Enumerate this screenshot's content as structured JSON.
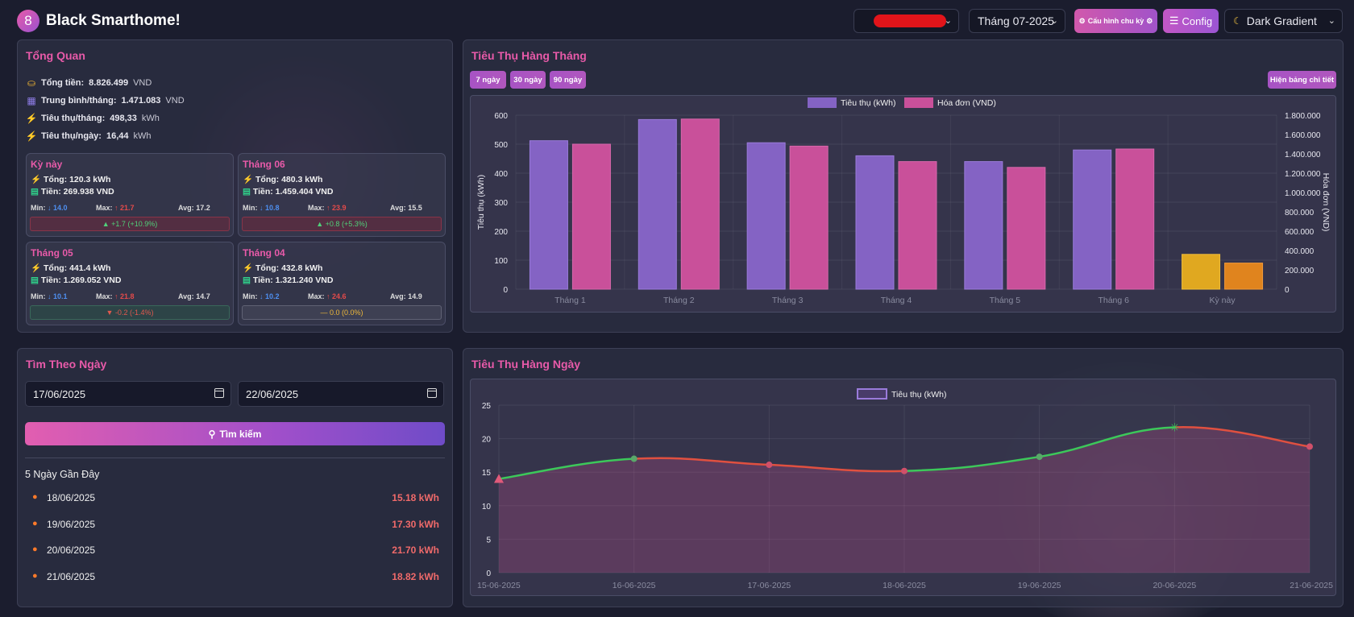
{
  "app": {
    "logo_text": "8",
    "title": "Black Smarthome!"
  },
  "header": {
    "month_select": "Tháng 07-2025",
    "cycle_button": "Cấu hình chu kỳ",
    "config_button": "Config",
    "theme_select": "Dark Gradient"
  },
  "overview": {
    "title": "Tổng Quan",
    "rows": [
      {
        "label": "Tổng tiền:",
        "value": "8.826.499",
        "unit": "VND"
      },
      {
        "label": "Trung bình/tháng:",
        "value": "1.471.083",
        "unit": "VND"
      },
      {
        "label": "Tiêu thụ/tháng:",
        "value": "498,33",
        "unit": "kWh"
      },
      {
        "label": "Tiêu thụ/ngày:",
        "value": "16,44",
        "unit": "kWh"
      }
    ],
    "cards": [
      {
        "title": "Kỳ này",
        "total": "Tổng: 120.3 kWh",
        "money": "Tiền: 269.938 VND",
        "min_label": "Min:",
        "min": "14.0",
        "max_label": "Max:",
        "max": "21.7",
        "avg_label": "Avg:",
        "avg": "17.2",
        "trend": "▲ +1.7 (+10.9%)"
      },
      {
        "title": "Tháng 06",
        "total": "Tổng: 480.3 kWh",
        "money": "Tiền: 1.459.404 VND",
        "min_label": "Min:",
        "min": "10.8",
        "max_label": "Max:",
        "max": "23.9",
        "avg_label": "Avg:",
        "avg": "15.5",
        "trend": "▲ +0.8 (+5.3%)"
      },
      {
        "title": "Tháng 05",
        "total": "Tổng: 441.4 kWh",
        "money": "Tiền: 1.269.052 VND",
        "min_label": "Min:",
        "min": "10.1",
        "max_label": "Max:",
        "max": "21.8",
        "avg_label": "Avg:",
        "avg": "14.7",
        "trend": "▼ -0.2 (-1.4%)"
      },
      {
        "title": "Tháng 04",
        "total": "Tổng: 432.8 kWh",
        "money": "Tiền: 1.321.240 VND",
        "min_label": "Min:",
        "min": "10.2",
        "max_label": "Max:",
        "max": "24.6",
        "avg_label": "Avg:",
        "avg": "14.9",
        "trend": "— 0.0 (0.0%)"
      }
    ]
  },
  "monthly": {
    "title": "Tiêu Thụ Hàng Tháng",
    "ranges": [
      "7 ngày",
      "30 ngày",
      "90 ngày"
    ],
    "detail_button": "Hiện bảng chi tiết"
  },
  "search": {
    "title": "Tìm Theo Ngày",
    "from_date": "17/06/2025",
    "to_date": "22/06/2025",
    "button": "Tìm kiếm",
    "recent_title": "5 Ngày Gần Đây",
    "recent": [
      {
        "date": "18/06/2025",
        "value": "15.18 kWh"
      },
      {
        "date": "19/06/2025",
        "value": "17.30 kWh"
      },
      {
        "date": "20/06/2025",
        "value": "21.70 kWh"
      },
      {
        "date": "21/06/2025",
        "value": "18.82 kWh"
      }
    ]
  },
  "daily": {
    "title": "Tiêu Thụ Hàng Ngày"
  },
  "colors": {
    "accent": "#e85aa9",
    "bar_kwh": "#8463c4",
    "bar_bill": "#c9509a",
    "bar_current_kwh": "#e0a820",
    "bar_current_bill": "#e0841e",
    "line_up": "#3cc85a",
    "line_down": "#e05040"
  },
  "chart_data": [
    {
      "type": "bar",
      "categories": [
        "Tháng 1",
        "Tháng 2",
        "Tháng 3",
        "Tháng 4",
        "Tháng 5",
        "Tháng 6",
        "Kỳ này"
      ],
      "series": [
        {
          "name": "Tiêu thụ (kWh)",
          "axis": "left",
          "values": [
            512,
            585,
            505,
            460,
            440,
            480,
            120
          ]
        },
        {
          "name": "Hóa đơn (VND)",
          "axis": "right",
          "values": [
            1500000,
            1760000,
            1480000,
            1320000,
            1260000,
            1450000,
            270000
          ]
        }
      ],
      "ylabel": "Tiêu thụ (kWh)",
      "y2label": "Hóa đơn (VND)",
      "ylim": [
        0,
        600
      ],
      "y2lim": [
        0,
        1800000
      ],
      "yticks": [
        "0",
        "100",
        "200",
        "300",
        "400",
        "500",
        "600"
      ],
      "y2ticks": [
        "0",
        "200.000",
        "400.000",
        "600.000",
        "800.000",
        "1.000.000",
        "1.200.000",
        "1.400.000",
        "1.600.000",
        "1.800.000"
      ],
      "legend": "top-center",
      "grid": true
    },
    {
      "type": "area",
      "x": [
        "15-06-2025",
        "16-06-2025",
        "17-06-2025",
        "18-06-2025",
        "19-06-2025",
        "20-06-2025",
        "21-06-2025"
      ],
      "series": [
        {
          "name": "Tiêu thụ (kWh)",
          "values": [
            14.0,
            17.0,
            16.1,
            15.18,
            17.3,
            21.7,
            18.82
          ]
        }
      ],
      "ylim": [
        0,
        25
      ],
      "yticks": [
        "0",
        "5",
        "10",
        "15",
        "20",
        "25"
      ],
      "legend": "top-center",
      "grid": true
    }
  ]
}
